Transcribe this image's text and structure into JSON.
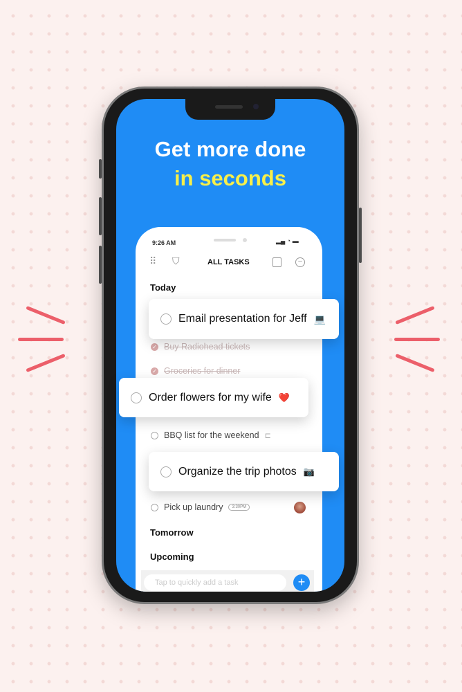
{
  "headline": {
    "line1": "Get more done",
    "line2": "in seconds",
    "line1_color": "#ffffff",
    "line2_color": "#f7ef4a"
  },
  "colors": {
    "screen": "#1f8cf5",
    "accent": "#ec5f6a"
  },
  "status_bar": {
    "time": "9:26 AM"
  },
  "toolbar": {
    "title": "ALL TASKS",
    "icons": [
      "grid-icon",
      "basket-icon",
      "note-icon",
      "more-icon"
    ]
  },
  "sections": {
    "today": "Today",
    "tomorrow": "Tomorrow",
    "upcoming": "Upcoming"
  },
  "tasks": [
    {
      "label": "Email presentation for Jeff",
      "emoji": "💻",
      "highlighted": true
    },
    {
      "label": "Buy Radiohead tickets",
      "done": true
    },
    {
      "label": "Groceries for dinner",
      "done": true
    },
    {
      "label": "Order flowers for my wife",
      "emoji": "❤️",
      "highlighted": true
    },
    {
      "label": "BBQ list for the weekend",
      "icon": "subtasks-icon"
    },
    {
      "label": "Organize the trip photos",
      "emoji": "📷",
      "highlighted": true
    },
    {
      "label": "Pick up laundry",
      "time_badge": "3:30PM",
      "avatar": true
    }
  ],
  "quick_add": {
    "placeholder": "Tap to quickly add a task",
    "button": "+"
  }
}
